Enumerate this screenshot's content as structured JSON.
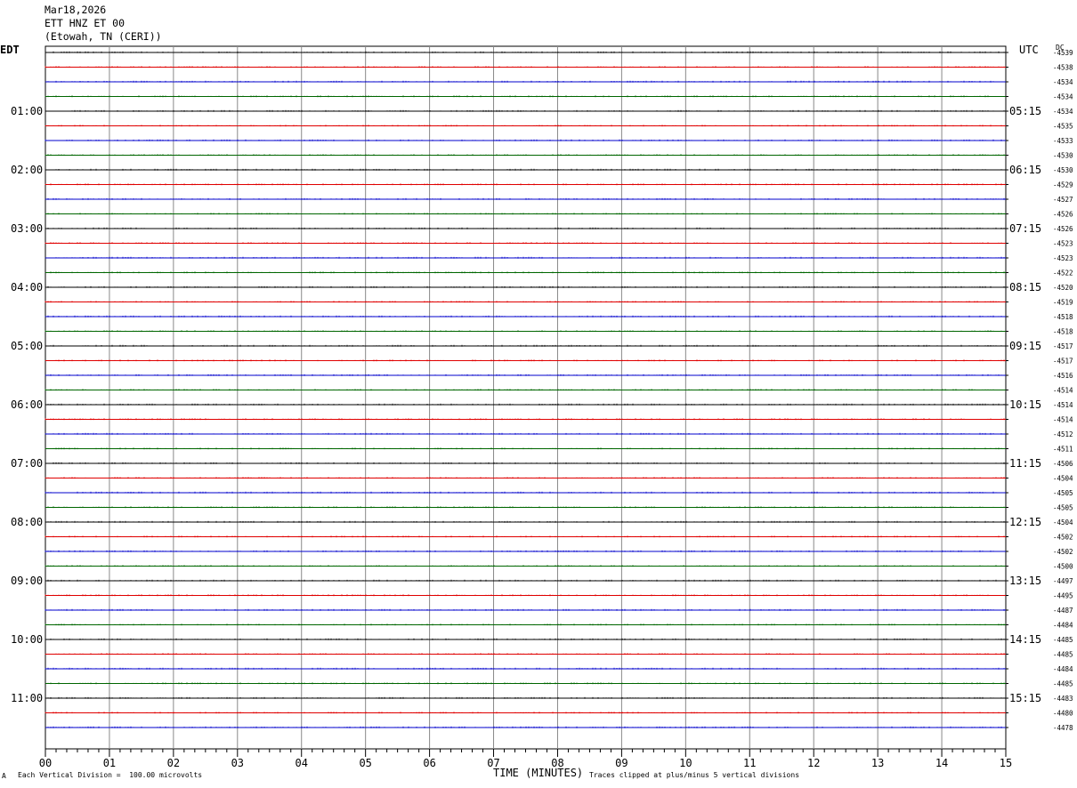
{
  "header": {
    "date": "Mar18,2026",
    "station": "ETT HNZ ET 00",
    "location": "(Etowah, TN (CERI))"
  },
  "left_timezone": "EDT",
  "right_timezone": "UTC",
  "dc_label": "DC",
  "footer": {
    "scale_note": "Each Vertical Division =  100.00 microvolts",
    "x_title": "TIME (MINUTES)",
    "clip_note": "Traces clipped at plus/minus 5 vertical divisions",
    "corner_mark": "A"
  },
  "chart_data": {
    "type": "line",
    "title": "",
    "xlabel": "TIME (MINUTES)",
    "xlim": [
      0,
      15
    ],
    "x_ticks": [
      "00",
      "01",
      "02",
      "03",
      "04",
      "05",
      "06",
      "07",
      "08",
      "09",
      "10",
      "11",
      "12",
      "13",
      "14",
      "15"
    ],
    "trace_colors": [
      "#000000",
      "#e00000",
      "#0000cc",
      "#006600"
    ],
    "grid": true,
    "left_hour_labels": [
      "01:00",
      "02:00",
      "03:00",
      "04:00",
      "05:00",
      "06:00",
      "07:00",
      "08:00",
      "09:00",
      "10:00",
      "11:00"
    ],
    "right_hour_labels": [
      "05:15",
      "06:15",
      "07:15",
      "08:15",
      "09:15",
      "10:15",
      "11:15",
      "12:15",
      "13:15",
      "14:15",
      "15:15"
    ],
    "dc_offsets": [
      "-4539",
      "-4538",
      "-4534",
      "-4534",
      "-4534",
      "-4535",
      "-4533",
      "-4530",
      "-4530",
      "-4529",
      "-4527",
      "-4526",
      "-4526",
      "-4523",
      "-4523",
      "-4522",
      "-4520",
      "-4519",
      "-4518",
      "-4518",
      "-4517",
      "-4517",
      "-4516",
      "-4514",
      "-4514",
      "-4514",
      "-4512",
      "-4511",
      "-4506",
      "-4504",
      "-4505",
      "-4505",
      "-4504",
      "-4502",
      "-4502",
      "-4500",
      "-4497",
      "-4495",
      "-4487",
      "-4484",
      "-4485",
      "-4485",
      "-4484",
      "-4485",
      "-4483",
      "-4480",
      "-4478"
    ]
  }
}
